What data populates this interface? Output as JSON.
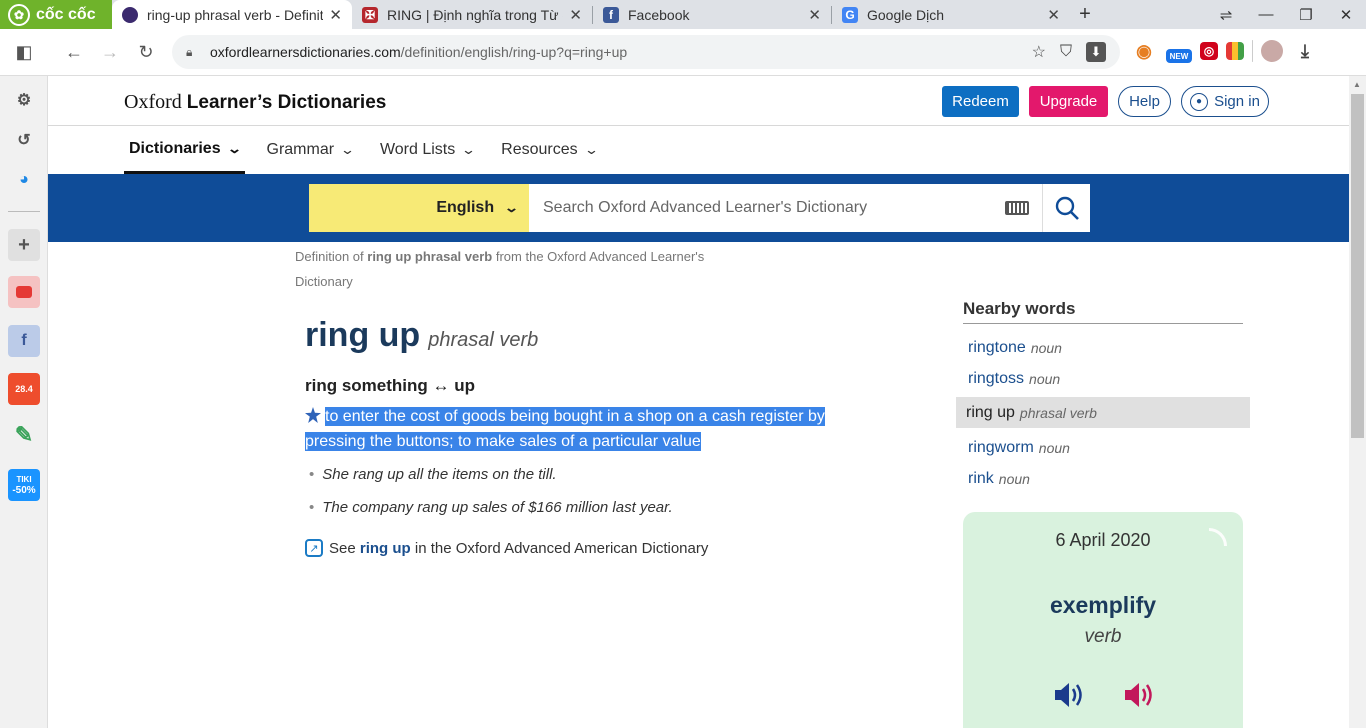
{
  "browser": {
    "brand": "cốc cốc",
    "tabs": [
      {
        "title": "ring-up phrasal verb - Definiti",
        "active": true
      },
      {
        "title": "RING | Định nghĩa trong Từ đ",
        "active": false
      },
      {
        "title": "Facebook",
        "active": false
      },
      {
        "title": "Google Dịch",
        "active": false
      }
    ],
    "url_host": "oxfordlearnersdictionaries.com",
    "url_path": "/definition/english/ring-up?q=ring+up",
    "ext_new_label": "NEW",
    "sidebar_tiki": "TIKI",
    "sidebar_tiki_badge": "-50%",
    "sidebar_shopee_badge": "28.4"
  },
  "site": {
    "logo_plain": "Oxford",
    "logo_bold": "Learner’s Dictionaries",
    "buttons": {
      "redeem": "Redeem",
      "upgrade": "Upgrade",
      "help": "Help",
      "signin": "Sign in"
    },
    "nav": [
      "Dictionaries",
      "Grammar",
      "Word Lists",
      "Resources"
    ],
    "search": {
      "language": "English",
      "placeholder": "Search Oxford Advanced Learner's Dictionary"
    }
  },
  "entry": {
    "breadcrumb_pre": "Definition of ",
    "breadcrumb_bold": "ring up phrasal verb",
    "breadcrumb_post": " from the Oxford Advanced Learner's Dictionary",
    "headword": "ring up",
    "pos": "phrasal verb",
    "pattern": "ring something ↔ up",
    "definition": "to enter the cost of goods being bought in a shop on a cash register by pressing the buttons; to make sales of a particular value",
    "examples": [
      "She rang up all the items on the till.",
      "The company rang up sales of $166 million last year."
    ],
    "see_pre": "See ",
    "see_link": "ring up",
    "see_post": " in the Oxford Advanced American Dictionary"
  },
  "nearby": {
    "heading": "Nearby words",
    "items": [
      {
        "word": "ringtone",
        "pos": "noun",
        "current": false
      },
      {
        "word": "ringtoss",
        "pos": "noun",
        "current": false
      },
      {
        "word": "ring up",
        "pos": "phrasal verb",
        "current": true
      },
      {
        "word": "ringworm",
        "pos": "noun",
        "current": false
      },
      {
        "word": "rink",
        "pos": "noun",
        "current": false
      }
    ]
  },
  "word_of_day": {
    "date": "6 April 2020",
    "word": "exemplify",
    "pos": "verb",
    "colors": {
      "bg": "#d9f2de",
      "uk": "#1b3a8c",
      "us": "#c2185b"
    }
  },
  "colors": {
    "blue_band": "#0f4c98",
    "redeem": "#0d6ec2",
    "upgrade": "#e3186c",
    "highlight": "#3a84e8",
    "lang_bg": "#f7ea76"
  }
}
